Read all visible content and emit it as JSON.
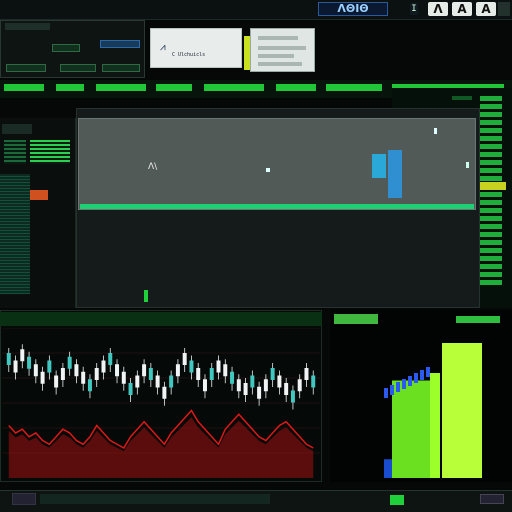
{
  "header": {
    "brand_badge": "ΛΘΙΘ",
    "marker": "I",
    "tool_buttons": [
      "Λ",
      "A",
      "A"
    ]
  },
  "panel_b": {
    "icon_glyph": "⩘",
    "label": "C Ulchuicls"
  },
  "main": {
    "plot_label": "Λ\\"
  },
  "colors": {
    "accent_green": "#20d03a",
    "accent_blue": "#2f8fd0",
    "alert_red": "#d31a1a",
    "bar_lime": "#9cff2a"
  },
  "bottom_left_chart": {
    "type": "candlestick",
    "series": [
      {
        "values": [
          64,
          60,
          66,
          62,
          58,
          54,
          60,
          52,
          56,
          62,
          58,
          54,
          50,
          56,
          60,
          64,
          58,
          54,
          48,
          52,
          58,
          56,
          52,
          46,
          52,
          58,
          64,
          60,
          56,
          50,
          56,
          60,
          58,
          54,
          50,
          48,
          52,
          46,
          50,
          56,
          52,
          48,
          44,
          50,
          56,
          52
        ]
      },
      {
        "values": [
          28,
          24,
          26,
          22,
          24,
          20,
          18,
          22,
          26,
          24,
          20,
          18,
          22,
          28,
          24,
          20,
          18,
          16,
          22,
          26,
          30,
          26,
          22,
          18,
          24,
          28,
          32,
          36,
          30,
          26,
          22,
          18,
          26,
          30,
          34,
          30,
          26,
          22,
          20,
          24,
          28,
          30,
          26,
          22,
          18,
          16
        ]
      }
    ]
  },
  "bottom_right_chart": {
    "type": "bar",
    "values": [
      10,
      30,
      52,
      56,
      72
    ]
  }
}
